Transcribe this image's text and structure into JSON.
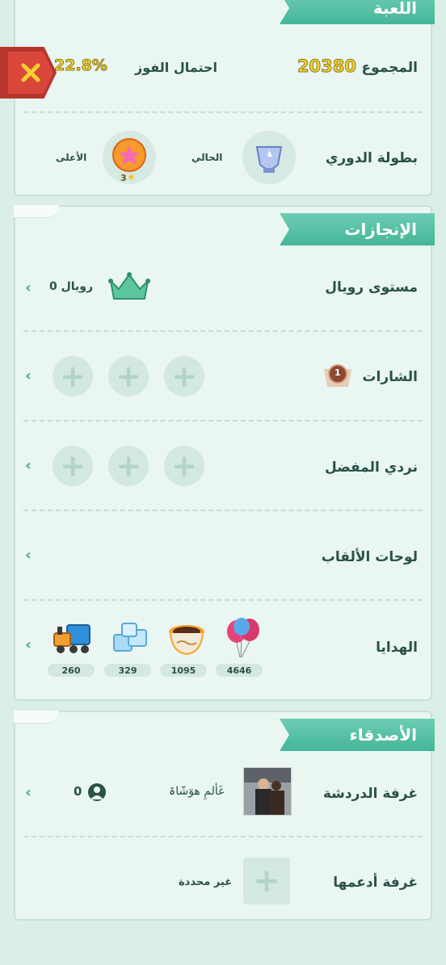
{
  "game": {
    "section_title": "اللعبة",
    "total_label": "المجموع",
    "total_value": "20380",
    "win_label": "احتمال الفوز",
    "win_value": "22.8%",
    "league_label": "بطولة الدوري",
    "current_label": "الحالي",
    "highest_label": "الأعلى",
    "highest_stars": "3"
  },
  "achievements": {
    "section_title": "الإنجازات",
    "royal_label": "مستوى رويال",
    "royal_value": "رويال 0",
    "badges_label": "الشارات",
    "badge_count": "1",
    "dice_label": "نردي المفضل",
    "titles_label": "لوحات الألقاب",
    "gifts_label": "الهدايا",
    "gifts": [
      {
        "name": "balloons",
        "count": "4646"
      },
      {
        "name": "coffee",
        "count": "1095"
      },
      {
        "name": "ice",
        "count": "329"
      },
      {
        "name": "train",
        "count": "260"
      }
    ]
  },
  "friends": {
    "section_title": "الأصدقاء",
    "chat_label": "غرفة الدردشة",
    "chat_room_name": "غَألمِ ھوٓشَٓاۃ",
    "chat_members": "0",
    "support_label": "غرفة أدعمها",
    "support_value": "غير محددة"
  },
  "icons": {
    "close": "close-icon",
    "arrow": "double-chevron-left-icon",
    "crown": "crown-icon",
    "person": "person-icon"
  },
  "colors": {
    "accent": "#45b598",
    "close": "#d9473b",
    "gold": "#f6d12e"
  }
}
